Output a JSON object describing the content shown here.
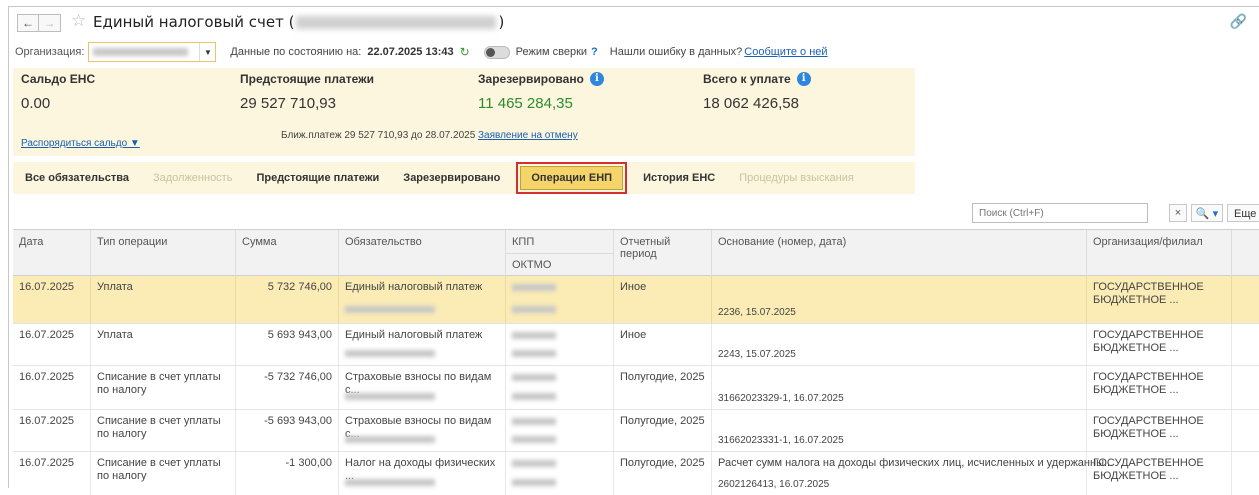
{
  "window": {
    "title": "Единый налоговый счет (",
    "title_close": ")"
  },
  "filters": {
    "org_label": "Организация:",
    "date_label": "Данные по состоянию на:",
    "date_value": "22.07.2025 13:43",
    "mode_label": "Режим сверки",
    "mode_help": "?",
    "error_text": "Нашли ошибку в данных?",
    "report_link": "Сообщите о ней"
  },
  "summary": {
    "balance_title": "Сальдо ЕНС",
    "balance_value": "0.00",
    "balance_link": "Распорядиться сальдо ▼",
    "upcoming_title": "Предстоящие платежи",
    "upcoming_value": "29 527 710,93",
    "upcoming_note": "Ближ.платеж 29 527 710,93 до 28.07.2025",
    "reserved_title": "Зарезервировано",
    "reserved_value": "11 465 284,35",
    "reserved_link": "Заявление на отмену",
    "total_title": "Всего к уплате",
    "total_value": "18 062 426,58",
    "accent_green": "#2e8b2e",
    "info_color": "#2e86de"
  },
  "tabs": [
    {
      "label": "Все обязательства",
      "state": "normal"
    },
    {
      "label": "Задолженность",
      "state": "disabled"
    },
    {
      "label": "Предстоящие платежи",
      "state": "normal"
    },
    {
      "label": "Зарезервировано",
      "state": "normal"
    },
    {
      "label": "Операции ЕНП",
      "state": "active"
    },
    {
      "label": "История ЕНС",
      "state": "normal"
    },
    {
      "label": "Процедуры взыскания",
      "state": "disabled"
    }
  ],
  "search": {
    "placeholder": "Поиск (Ctrl+F)",
    "clear": "×",
    "search_icon": "magnifier-icon",
    "search_glyph": "🔍 ▾",
    "more_label": "Еще ▾"
  },
  "table": {
    "headers": {
      "date": "Дата",
      "op_type": "Тип операции",
      "amount": "Сумма",
      "obligation": "Обязательство",
      "kpp": "КПП",
      "oktmo": "ОКТМО",
      "period": "Отчетный период",
      "basis": "Основание (номер, дата)",
      "org": "Организация/филиал"
    },
    "rows": [
      {
        "date": "16.07.2025",
        "op_type": "Уплата",
        "amount": "5 732 746,00",
        "obligation": "Единый налоговый платеж",
        "period": "Иное",
        "basis_top": "",
        "basis": "2236, 15.07.2025",
        "org": "ГОСУДАРСТВЕННОЕ БЮДЖЕТНОЕ ..."
      },
      {
        "date": "16.07.2025",
        "op_type": "Уплата",
        "amount": "5 693 943,00",
        "obligation": "Единый налоговый платеж",
        "period": "Иное",
        "basis_top": "",
        "basis": "2243, 15.07.2025",
        "org": "ГОСУДАРСТВЕННОЕ БЮДЖЕТНОЕ ..."
      },
      {
        "date": "16.07.2025",
        "op_type": "Списание в счет уплаты по налогу",
        "amount": "-5 732 746,00",
        "obligation": "Страховые взносы по видам с...",
        "period": "Полугодие, 2025",
        "basis_top": "",
        "basis": "31662023329-1, 16.07.2025",
        "org": "ГОСУДАРСТВЕННОЕ БЮДЖЕТНОЕ ..."
      },
      {
        "date": "16.07.2025",
        "op_type": "Списание в счет уплаты по налогу",
        "amount": "-5 693 943,00",
        "obligation": "Страховые взносы по видам с...",
        "period": "Полугодие, 2025",
        "basis_top": "",
        "basis": "31662023331-1, 16.07.2025",
        "org": "ГОСУДАРСТВЕННОЕ БЮДЖЕТНОЕ ..."
      },
      {
        "date": "16.07.2025",
        "op_type": "Списание в счет уплаты по налогу",
        "amount": "-1 300,00",
        "obligation": "Налог на доходы физических ...",
        "period": "Полугодие, 2025",
        "basis_top": "Расчет сумм налога на доходы физических лиц, исчисленных и удержанны...",
        "basis": "2602126413, 16.07.2025",
        "org": "ГОСУДАРСТВЕННОЕ БЮДЖЕТНОЕ ..."
      }
    ]
  }
}
